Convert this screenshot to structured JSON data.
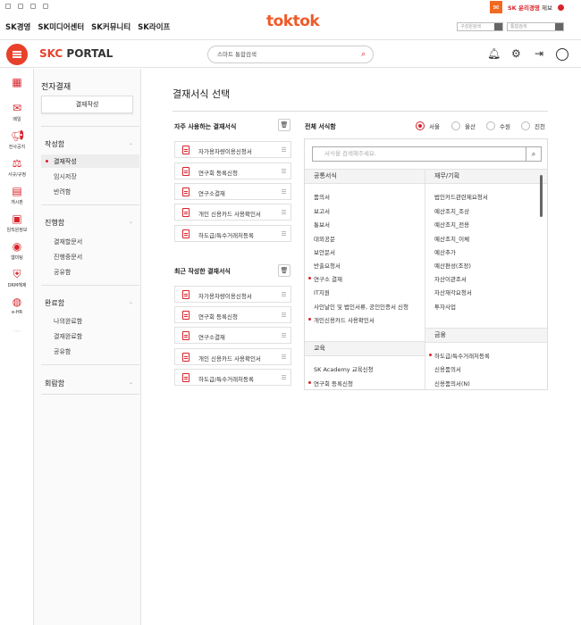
{
  "ethics": {
    "label_accent": "SK 윤리경영",
    "label_rest": " 제보"
  },
  "top_links": [
    "SK경영",
    "SK미디어센터",
    "SK커뮤니티",
    "SK라이프"
  ],
  "logo": "toktok",
  "top_search": {
    "placeholder1": "구성원검색",
    "placeholder2": "통합검색"
  },
  "portal": {
    "logo_a": "SKC",
    "logo_b": "PORTAL"
  },
  "main_search": {
    "placeholder": "스마트 통합검색"
  },
  "rail": [
    {
      "label": "",
      "icon": "apps-icon"
    },
    {
      "label": "메일",
      "icon": "mail-icon"
    },
    {
      "label": "전사공지",
      "icon": "megaphone-icon"
    },
    {
      "label": "사규/규정",
      "icon": "scale-icon"
    },
    {
      "label": "게시판",
      "icon": "board-icon"
    },
    {
      "label": "임직원정보",
      "icon": "person-card-icon"
    },
    {
      "label": "웹미팅",
      "icon": "webmeeting-icon"
    },
    {
      "label": "DRM해제",
      "icon": "shield-icon"
    },
    {
      "label": "e-HR",
      "icon": "ehr-icon"
    }
  ],
  "sidebar": {
    "title": "전자결재",
    "compose": "결재작성",
    "sections": [
      {
        "title": "작성함",
        "items": [
          "결재작성",
          "임시저장",
          "반려함"
        ]
      },
      {
        "title": "진행함",
        "items": [
          "결재할문서",
          "진행중문서",
          "공유함"
        ]
      },
      {
        "title": "완료함",
        "items": [
          "나의완료함",
          "결재완료함",
          "공유함"
        ]
      },
      {
        "title": "회람함",
        "items": []
      }
    ]
  },
  "main": {
    "title": "결재서식 선택",
    "frequent_title": "자주 사용하는 결재서식",
    "recent_title": "최근 작성한 결재서식",
    "frequent": [
      "자가용차량이용신청서",
      "연구회 등록신청",
      "연구소결재",
      "개인 신용카드 사용확인서",
      "하도급/특수거래처등록"
    ],
    "recent": [
      "자가용차량이용신청서",
      "연구회 등록신청",
      "연구소결재",
      "개인 신용카드 사용확인서",
      "하도급/특수거래처등록"
    ],
    "all_title": "전체 서식함",
    "locations": [
      "서울",
      "울산",
      "수원",
      "진천"
    ],
    "selected_location": "서울",
    "all_search_placeholder": "서식을 검색해주세요.",
    "col1": {
      "head": "공통서식",
      "items": [
        "품의서",
        "보고서",
        "통보서",
        "대외공문",
        "보안문서",
        "반출요청서",
        "연구소 결재",
        "IT지원",
        "사인날인 및 법인서류, 공인인증서 신청",
        "개인신용카드 사용확인서"
      ],
      "head2": "교육",
      "items2": [
        "SK Academy 교육신청",
        "연구회 등록신청"
      ]
    },
    "col2": {
      "head": "재무/기획",
      "items": [
        "법인카드관련제요청서",
        "예산조치_조상",
        "예산조치_전용",
        "예산조치_이체",
        "예산추가",
        "예산편성(조정)",
        "자산이관조서",
        "자산재각요청서",
        "투자사업"
      ],
      "head2": "금융",
      "items2": [
        "하도급/특수거래처등록",
        "신용품의서",
        "신용품의서(N)"
      ]
    }
  }
}
